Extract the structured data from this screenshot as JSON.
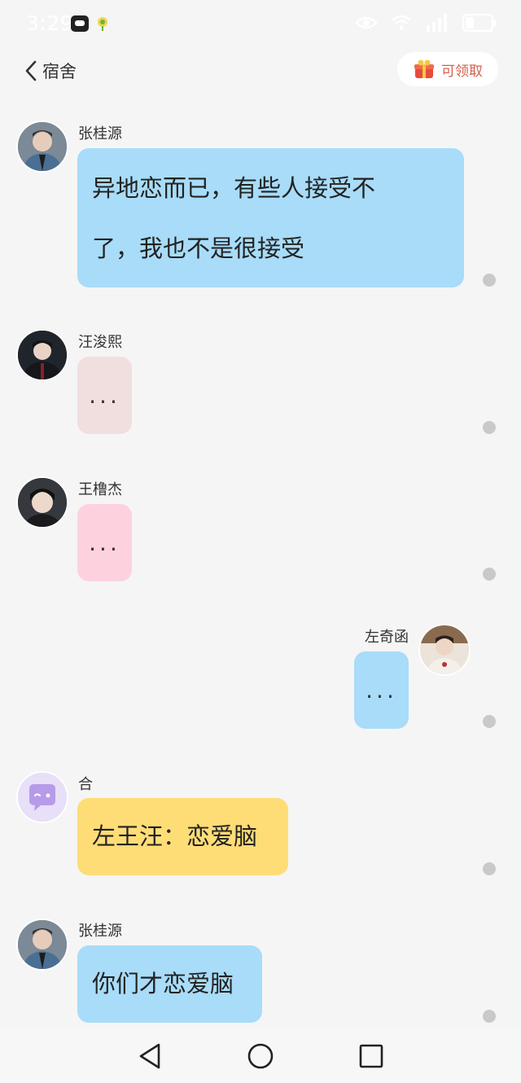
{
  "status_bar": {
    "time": "3:29",
    "icons": [
      "notification-app-icon",
      "notification-app-icon",
      "eye-icon",
      "wifi-icon",
      "signal-icon",
      "battery-icon"
    ]
  },
  "header": {
    "title": "宿舍",
    "claim_label": "可领取"
  },
  "messages": [
    {
      "sender": "张桂源",
      "text_line1": "异地恋而已，有些人接受不",
      "text_line2": "了，我也不是很接受",
      "bubble_color": "#a8dcf8"
    },
    {
      "sender": "汪浚熙",
      "text": "...",
      "bubble_color": "#f1dfe0"
    },
    {
      "sender": "王橹杰",
      "text": "...",
      "bubble_color": "#fdd2de"
    },
    {
      "sender": "左奇函",
      "text": "...",
      "bubble_color": "#a8dcf8"
    },
    {
      "sender": "合",
      "text": "左王汪：恋爱脑",
      "bubble_color": "#fedd77"
    },
    {
      "sender": "张桂源",
      "text": "你们才恋爱脑",
      "bubble_color": "#a8dcf8"
    }
  ],
  "nav": {
    "icons": [
      "back-triangle-icon",
      "home-circle-icon",
      "recents-square-icon"
    ]
  }
}
